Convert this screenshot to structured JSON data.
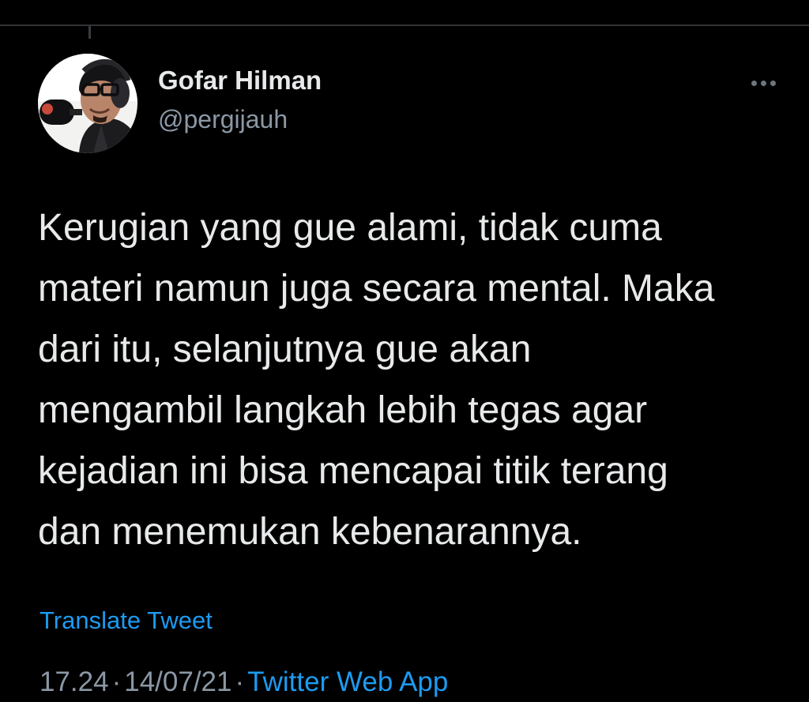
{
  "tweet": {
    "author": {
      "display_name": "Gofar Hilman",
      "handle": "@pergijauh",
      "avatar_icon": "user-avatar-photo"
    },
    "more_icon": "more-horizontal-icon",
    "text": "Kerugian yang gue alami, tidak cuma\nmateri namun juga secara mental. Maka\ndari itu, selanjutnya gue akan\nmengambil langkah lebih tegas agar\nkejadian ini bisa mencapai titik terang\ndan menemukan kebenarannya.",
    "translate_label": "Translate Tweet",
    "time": "17.24",
    "date": "14/07/21",
    "separator": "·",
    "source": "Twitter Web App"
  },
  "colors": {
    "background": "#000000",
    "primary_text": "#e7e9ea",
    "secondary_text": "#8b98a5",
    "link": "#1d9bf0",
    "divider": "#2f3336"
  }
}
